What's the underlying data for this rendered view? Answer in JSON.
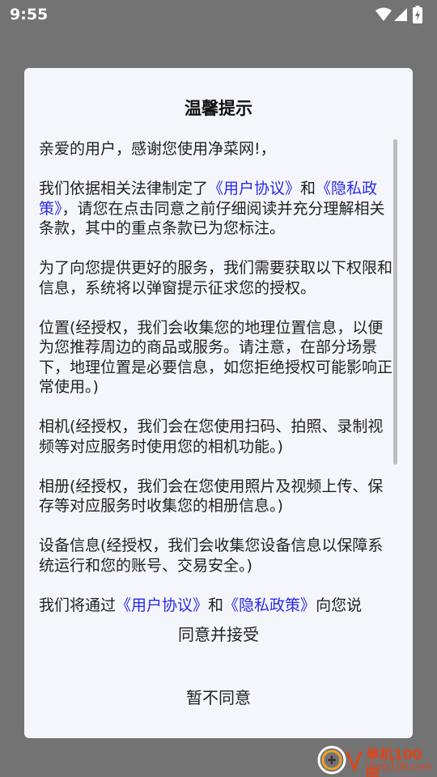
{
  "status_bar": {
    "time": "9:55",
    "icons": [
      "wifi-icon",
      "signal-icon",
      "battery-charging-icon"
    ]
  },
  "dialog": {
    "title": "温馨提示",
    "paragraphs": {
      "p1": "亲爱的用户，感谢您使用净菜网!，",
      "p2_a": "我们依据相关法律制定了",
      "p2_link1": "《用户协议》",
      "p2_b": "和",
      "p2_link2": "《隐私政策》",
      "p2_c": "，请您在点击同意之前仔细阅读并充分理解相关条款，其中的重点条款已为您标注。",
      "p3": "为了向您提供更好的服务，我们需要获取以下权限和信息，系统将以弹窗提示征求您的授权。",
      "p4": "位置(经授权，我们会收集您的地理位置信息，以便为您推荐周边的商品或服务。请注意，在部分场景下，地理位置是必要信息，如您拒绝授权可能影响正常使用。)",
      "p5": "相机(经授权，我们会在您使用扫码、拍照、录制视频等对应服务时使用您的相机功能。)",
      "p6": "相册(经授权，我们会在您使用照片及视频上传、保存等对应服务时收集您的相册信息。)",
      "p7": "设备信息(经授权，我们会收集您设备信息以保障系统运行和您的账号、交易安全。)",
      "p8_a": "我们将通过",
      "p8_link1": "《用户协议》",
      "p8_b": "和",
      "p8_link2": "《隐私政策》",
      "p8_c": "向您说"
    },
    "accept_label": "同意并接受",
    "decline_label": "暂不同意"
  },
  "watermark": {
    "name": "单机100网",
    "url": "danji100.com"
  },
  "colors": {
    "backdrop": "#737373",
    "dialog_bg": "#f5f6fb",
    "link": "#2a2ae6",
    "watermark": "#e0451a"
  }
}
